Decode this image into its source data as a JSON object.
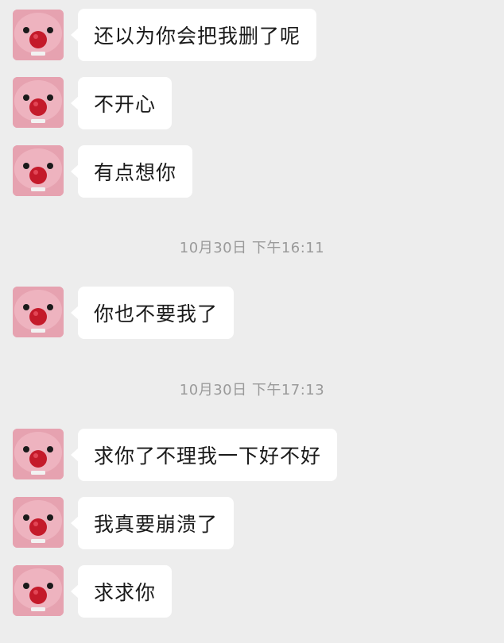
{
  "conversation": {
    "messages": [
      {
        "sender": "contact",
        "text": "还以为你会把我删了呢"
      },
      {
        "sender": "contact",
        "text": "不开心"
      },
      {
        "sender": "contact",
        "text": "有点想你"
      },
      {
        "timestamp": "10月30日 下午16:11"
      },
      {
        "sender": "contact",
        "text": "你也不要我了"
      },
      {
        "timestamp": "10月30日 下午17:13"
      },
      {
        "sender": "contact",
        "text": "求你了不理我一下好不好"
      },
      {
        "sender": "contact",
        "text": "我真要崩溃了"
      },
      {
        "sender": "contact",
        "text": "求求你"
      }
    ]
  },
  "avatar": {
    "icon": "pink-plush-face-icon",
    "colors": {
      "skin": "#e6a2b0",
      "nose": "#c41a2a",
      "eyes": "#1a1a1a"
    }
  }
}
